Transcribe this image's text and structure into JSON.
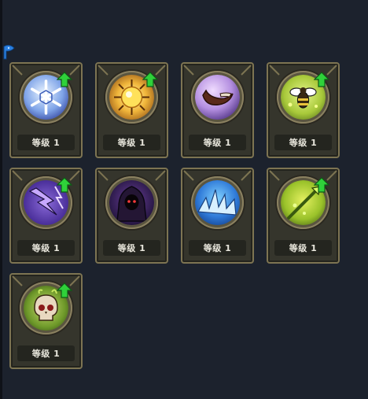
{
  "colors": {
    "background": "#1c222d",
    "card_fill": "#35352c",
    "card_border": "#7d7452",
    "level_bar": "#24251f",
    "upgrade_green": "#2fd13a"
  },
  "corner_marker_icon": "blue-flag-marker-icon",
  "skills": [
    {
      "icon": "ice-snowflake-icon",
      "level_label": "等级 1",
      "upgradable": true
    },
    {
      "icon": "golden-light-orb-icon",
      "level_label": "等级 1",
      "upgradable": true
    },
    {
      "icon": "boomerang-blade-icon",
      "level_label": "等级 1",
      "upgradable": false
    },
    {
      "icon": "firefly-bee-icon",
      "level_label": "等级 1",
      "upgradable": true
    },
    {
      "icon": "purple-lightning-icon",
      "level_label": "等级 1",
      "upgradable": true
    },
    {
      "icon": "dark-reaper-icon",
      "level_label": "等级 1",
      "upgradable": false
    },
    {
      "icon": "ice-shards-icon",
      "level_label": "等级 1",
      "upgradable": false
    },
    {
      "icon": "poison-spear-icon",
      "level_label": "等级 1",
      "upgradable": true
    },
    {
      "icon": "toxic-skull-icon",
      "level_label": "等级 1",
      "upgradable": true
    }
  ]
}
